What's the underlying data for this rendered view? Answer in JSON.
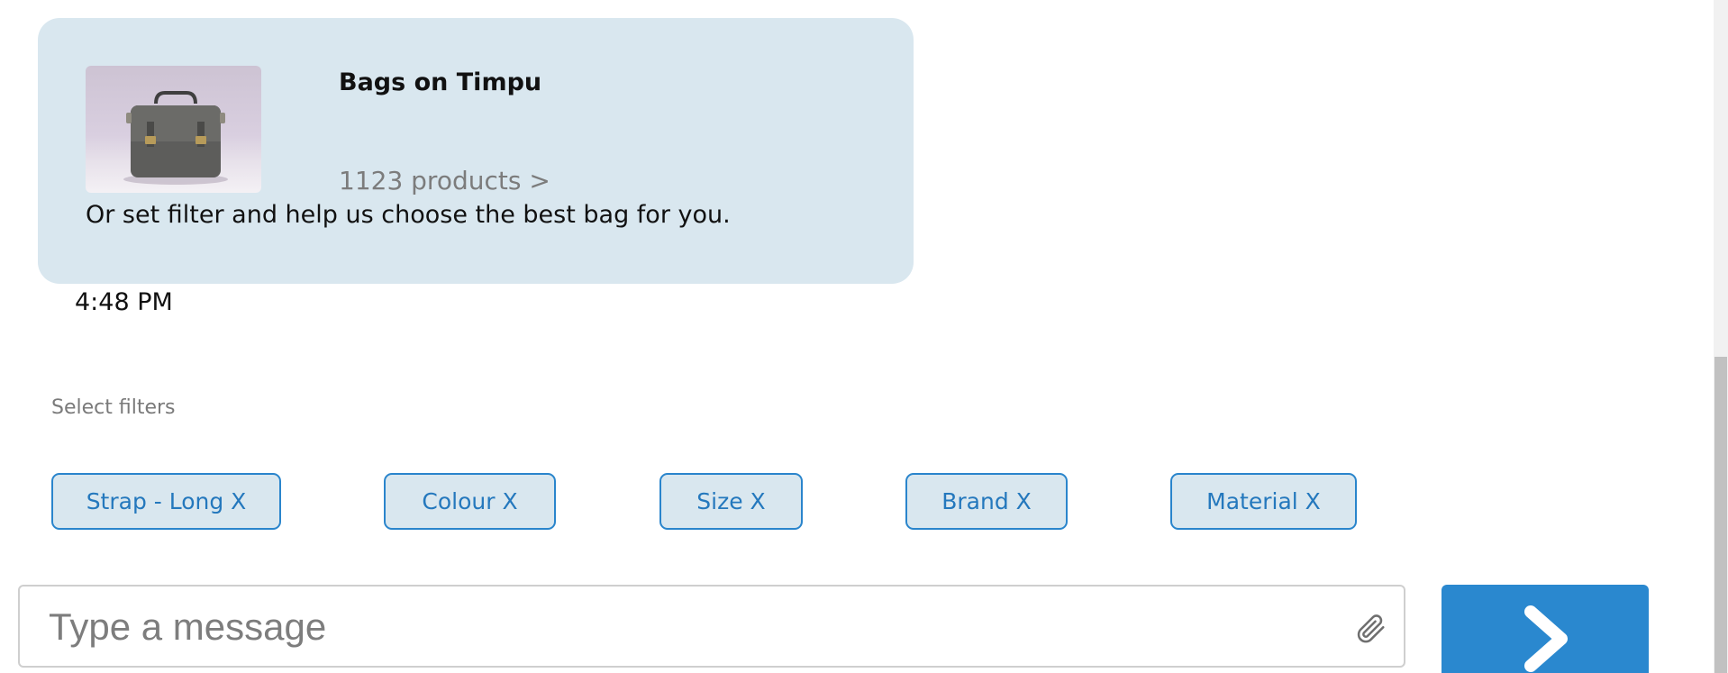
{
  "card": {
    "title": "Bags on Timpu",
    "products_link": "1123 products >",
    "message": "Or set filter and help us choose the best bag for you.",
    "image_label": "bag-photo"
  },
  "timestamp": "4:48 PM",
  "filters": {
    "label": "Select filters",
    "chips": [
      "Strap - Long X",
      "Colour X",
      "Size X",
      "Brand X",
      "Material X"
    ]
  },
  "composer": {
    "placeholder": "Type a message",
    "attach_icon": "paperclip-icon",
    "send_icon": "chevron-right-icon"
  },
  "colors": {
    "bubble_bg": "#d9e7ef",
    "accent": "#2a88cf",
    "chip_border": "#2a85cc",
    "chip_text": "#2478bd"
  }
}
